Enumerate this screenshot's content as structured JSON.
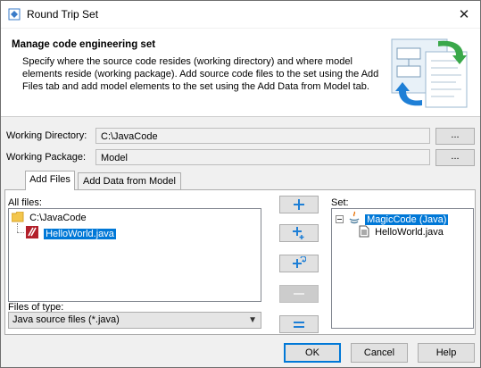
{
  "window": {
    "title": "Round Trip Set"
  },
  "header": {
    "title": "Manage code engineering set",
    "description": "Specify where the source code resides (working directory) and where model elements reside (working package). Add source code files to the set using the Add Files tab and add model elements to the set using the Add Data from Model tab."
  },
  "working_directory": {
    "label": "Working Directory:",
    "value": "C:\\JavaCode",
    "browse_label": "..."
  },
  "working_package": {
    "label": "Working Package:",
    "value": "Model",
    "browse_label": "..."
  },
  "tabs": [
    {
      "label": "Add Files",
      "active": true
    },
    {
      "label": "Add Data from Model",
      "active": false
    }
  ],
  "all_files": {
    "label": "All files:",
    "folder": "C:\\JavaCode",
    "file": "HelloWorld.java"
  },
  "files_of_type": {
    "label": "Files of type:",
    "value": "Java source files (*.java)"
  },
  "set": {
    "label": "Set:",
    "root": "MagicCode (Java)",
    "child": "HelloWorld.java"
  },
  "buttons": {
    "ok": "OK",
    "cancel": "Cancel",
    "help": "Help"
  },
  "colors": {
    "selection": "#0078d7",
    "button_icon": "#1e7fd6"
  }
}
